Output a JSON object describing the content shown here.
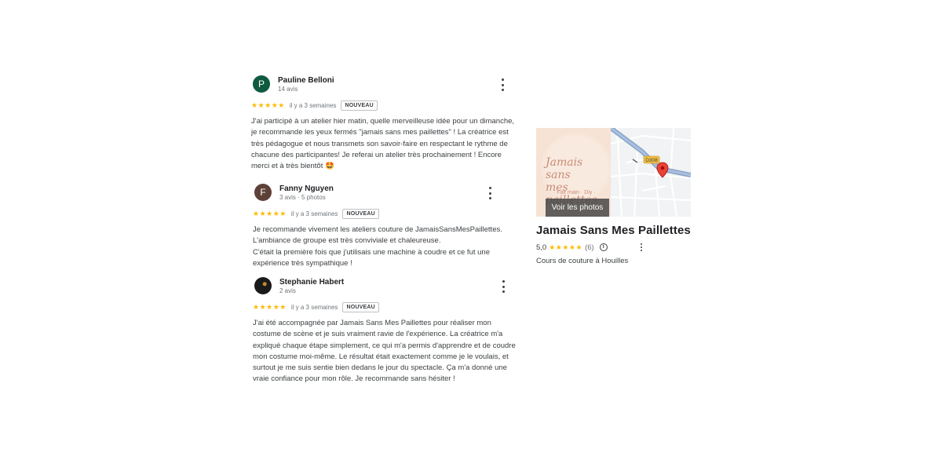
{
  "reviews": [
    {
      "initial": "P",
      "avatar_color": "#0e5a3f",
      "name": "Pauline Belloni",
      "meta": "14 avis",
      "stars": "★★★★★",
      "date": "il y a 3 semaines",
      "badge": "NOUVEAU",
      "text": "J'ai participé à un atelier hier matin, quelle merveilleuse idée pour un dimanche,\nje recommande les yeux fermés \"jamais sans mes paillettes\" !  La créatrice est\ntrès pédagogue et nous transmets son savoir-faire en respectant le rythme de\nchacune des participantes! Je referai un atelier très prochainement ! Encore\nmerci et à très bientôt 🤩"
    },
    {
      "initial": "F",
      "avatar_color": "#5d4037",
      "name": "Fanny Nguyen",
      "meta": "3 avis · 5 photos",
      "stars": "★★★★★",
      "date": "il y a 3 semaines",
      "badge": "NOUVEAU",
      "text": "Je recommande vivement les ateliers couture de JamaisSansMesPaillettes.\nL'ambiance de groupe est très conviviale et chaleureuse.\nC'était la première fois que j'utilisais une machine à coudre et ce fut une\nexpérience très sympathique !"
    },
    {
      "initial": "",
      "avatar_color": "#1a1a1a",
      "name": "Stephanie Habert",
      "meta": "2 avis",
      "stars": "★★★★★",
      "date": "il y a 3 semaines",
      "badge": "NOUVEAU",
      "text": "J'ai été accompagnée par Jamais Sans Mes Paillettes pour réaliser mon\ncostume de scène et je suis vraiment ravie de l'expérience. La créatrice m'a\nexpliqué chaque étape simplement, ce qui m'a permis d'apprendre et de coudre\nmon costume moi-même. Le résultat était exactement comme je le voulais, et\nsurtout je me suis sentie bien dedans le jour du spectacle. Ça m'a donné une\nvraie confiance pour mon rôle. Je recommande sans hésiter !"
    }
  ],
  "place": {
    "logo_text": "Jamais sans\nmes paillettes",
    "logo_sub": "· Fait main · Diy ·",
    "map_road_label": "D308",
    "photos_button": "Voir les photos",
    "title": "Jamais Sans Mes Paillettes",
    "rating": "5,0",
    "stars": "★★★★★",
    "count": "(6)",
    "info_icon": "i",
    "category": "Cours de couture à Houilles"
  }
}
